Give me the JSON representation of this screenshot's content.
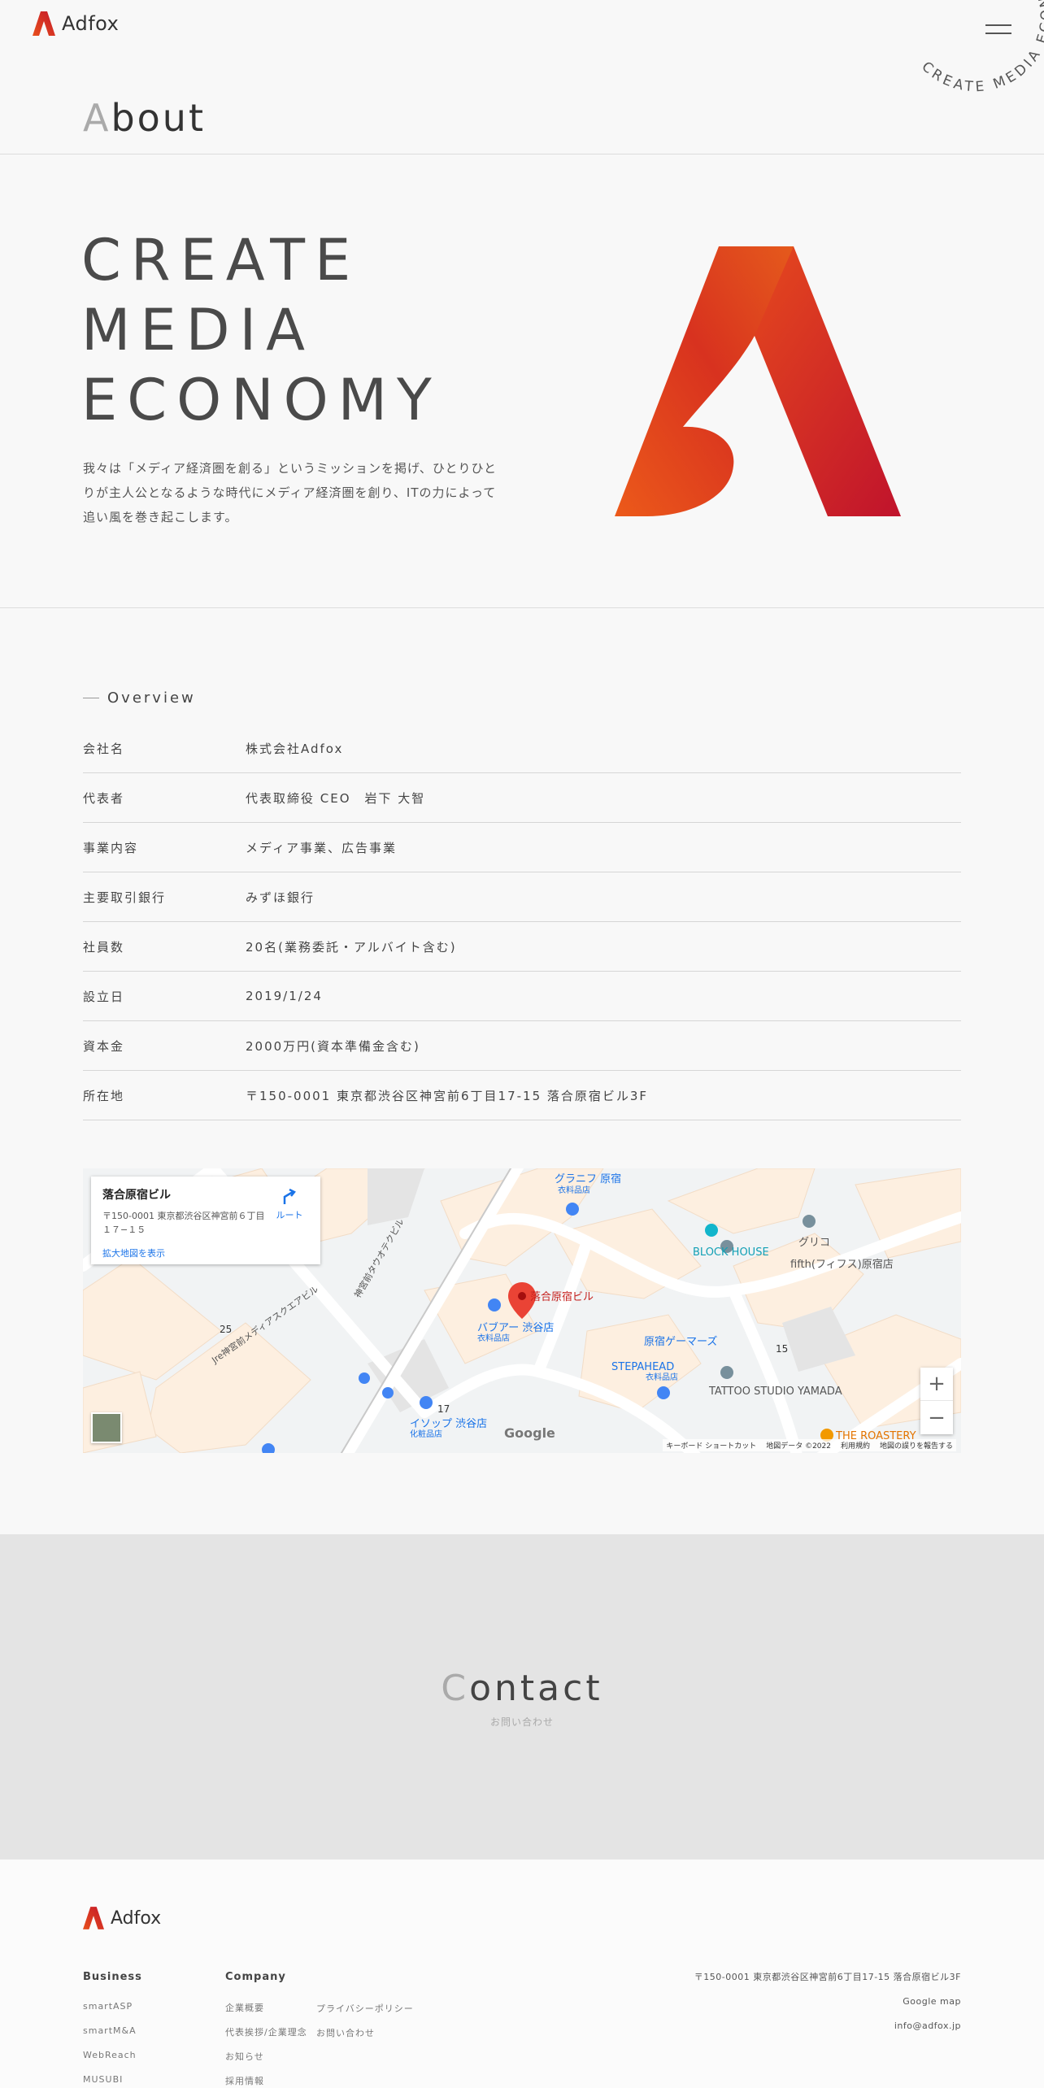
{
  "header": {
    "logo_text": "Adfox",
    "rotating_text": "CREATE MEDIA ECONOMY ",
    "page_title_first": "A",
    "page_title_rest": "bout"
  },
  "hero": {
    "tagline": [
      "CREATE",
      "MEDIA",
      "ECONOMY"
    ],
    "mission": "我々は「メディア経済圏を創る」というミッションを掲げ、ひとりひとりが主人公となるような時代にメディア経済圏を創り、ITの力によって追い風を巻き起こします。"
  },
  "overview": {
    "heading": "Overview",
    "rows": [
      {
        "k": "会社名",
        "v": "株式会社Adfox"
      },
      {
        "k": "代表者",
        "v": "代表取締役 CEO　岩下 大智"
      },
      {
        "k": "事業内容",
        "v": "メディア事業、広告事業"
      },
      {
        "k": "主要取引銀行",
        "v": "みずほ銀行"
      },
      {
        "k": "社員数",
        "v": "20名(業務委託・アルバイト含む)"
      },
      {
        "k": "設立日",
        "v": "2019/1/24"
      },
      {
        "k": "資本金",
        "v": "2000万円(資本準備金含む)"
      },
      {
        "k": "所在地",
        "v": "〒150-0001 東京都渋谷区神宮前6丁目17-15 落合原宿ビル3F"
      }
    ]
  },
  "map": {
    "place_name": "落合原宿ビル",
    "place_address": "〒150-0001 東京都渋谷区神宮前６丁目１７−１５",
    "enlarge_link": "拡大地図を表示",
    "route_label": "ルート",
    "pin_label": "落合原宿ビル",
    "labels": [
      {
        "text": "グラニフ 原宿",
        "sub": "衣料品店"
      },
      {
        "text": "BLOCK HOUSE",
        "sub": ""
      },
      {
        "text": "グリコ",
        "sub": ""
      },
      {
        "text": "fifth(フィフス)原宿店",
        "sub": ""
      },
      {
        "text": "バブアー 渋谷店",
        "sub": "衣料品店"
      },
      {
        "text": "原宿ゲーマーズ",
        "sub": ""
      },
      {
        "text": "STEPAHEAD",
        "sub": "衣料品店"
      },
      {
        "text": "TATTOO STUDIO YAMADA",
        "sub": ""
      },
      {
        "text": "イソップ 渋谷店",
        "sub": "化粧品店"
      },
      {
        "text": "THE ROASTERY",
        "sub": ""
      },
      {
        "text": "Jre神宮前メディアスクエアビル",
        "sub": ""
      },
      {
        "text": "神宮前タウオテクビル",
        "sub": ""
      }
    ],
    "numbers": [
      "25",
      "17",
      "15"
    ],
    "google": "Google",
    "footer_items": [
      "キーボード ショートカット",
      "地図データ ©2022",
      "利用規約",
      "地図の誤りを報告する"
    ],
    "zoom_in": "+",
    "zoom_out": "−"
  },
  "contact": {
    "title_first": "C",
    "title_rest": "ontact",
    "sub": "お問い合わせ"
  },
  "footer": {
    "logo_text": "Adfox",
    "business_heading": "Business",
    "business_links": [
      "smartASP",
      "smartM&A",
      "WebReach",
      "MUSUBI"
    ],
    "company_heading": "Company",
    "company_links_col1": [
      "企業概要",
      "代表挨拶/企業理念",
      "お知らせ",
      "採用情報"
    ],
    "company_links_col2": [
      "プライバシーポリシー",
      "お問い合わせ"
    ],
    "address": "〒150-0001 東京都渋谷区神宮前6丁目17-15 落合原宿ビル3F",
    "google_map": "Google map",
    "email": "info@adfox.jp"
  },
  "colors": {
    "brand_orange": "#e8501c",
    "brand_red": "#c4182a",
    "contact_bg": "#e4e4e4"
  }
}
